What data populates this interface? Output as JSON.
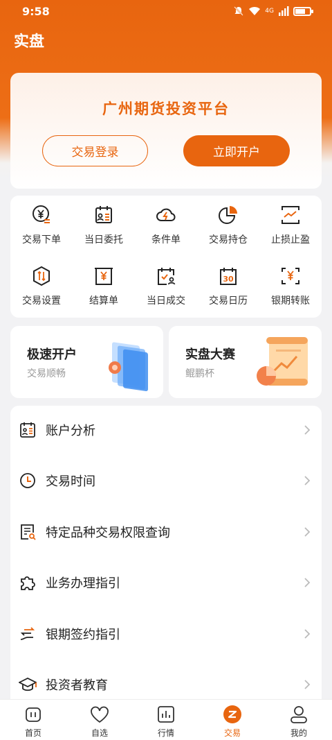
{
  "status": {
    "time": "9:58",
    "network": "4G"
  },
  "header": {
    "title": "实盘"
  },
  "hero": {
    "title": "广州期货投资平台",
    "login_label": "交易登录",
    "open_label": "立即开户"
  },
  "functions": [
    {
      "label": "交易下单",
      "icon": "yen-order-icon"
    },
    {
      "label": "当日委托",
      "icon": "entrust-icon"
    },
    {
      "label": "条件单",
      "icon": "cloud-bolt-icon"
    },
    {
      "label": "交易持仓",
      "icon": "pie-chart-icon"
    },
    {
      "label": "止损止盈",
      "icon": "trend-frame-icon"
    },
    {
      "label": "交易设置",
      "icon": "hex-settings-icon"
    },
    {
      "label": "结算单",
      "icon": "settlement-icon"
    },
    {
      "label": "当日成交",
      "icon": "calendar-user-icon"
    },
    {
      "label": "交易日历",
      "icon": "calendar-30-icon"
    },
    {
      "label": "银期转账",
      "icon": "bank-transfer-icon"
    }
  ],
  "promos": [
    {
      "title": "极速开户",
      "subtitle": "交易顺畅"
    },
    {
      "title": "实盘大赛",
      "subtitle": "鲲鹏杯"
    }
  ],
  "menu": [
    {
      "label": "账户分析"
    },
    {
      "label": "交易时间"
    },
    {
      "label": "特定品种交易权限查询"
    },
    {
      "label": "业务办理指引"
    },
    {
      "label": "银期签约指引"
    },
    {
      "label": "投资者教育"
    }
  ],
  "tabs": [
    {
      "label": "首页"
    },
    {
      "label": "自选"
    },
    {
      "label": "行情"
    },
    {
      "label": "交易"
    },
    {
      "label": "我的"
    }
  ],
  "colors": {
    "accent": "#e8650f",
    "dark": "#222222",
    "muted": "#999999"
  }
}
